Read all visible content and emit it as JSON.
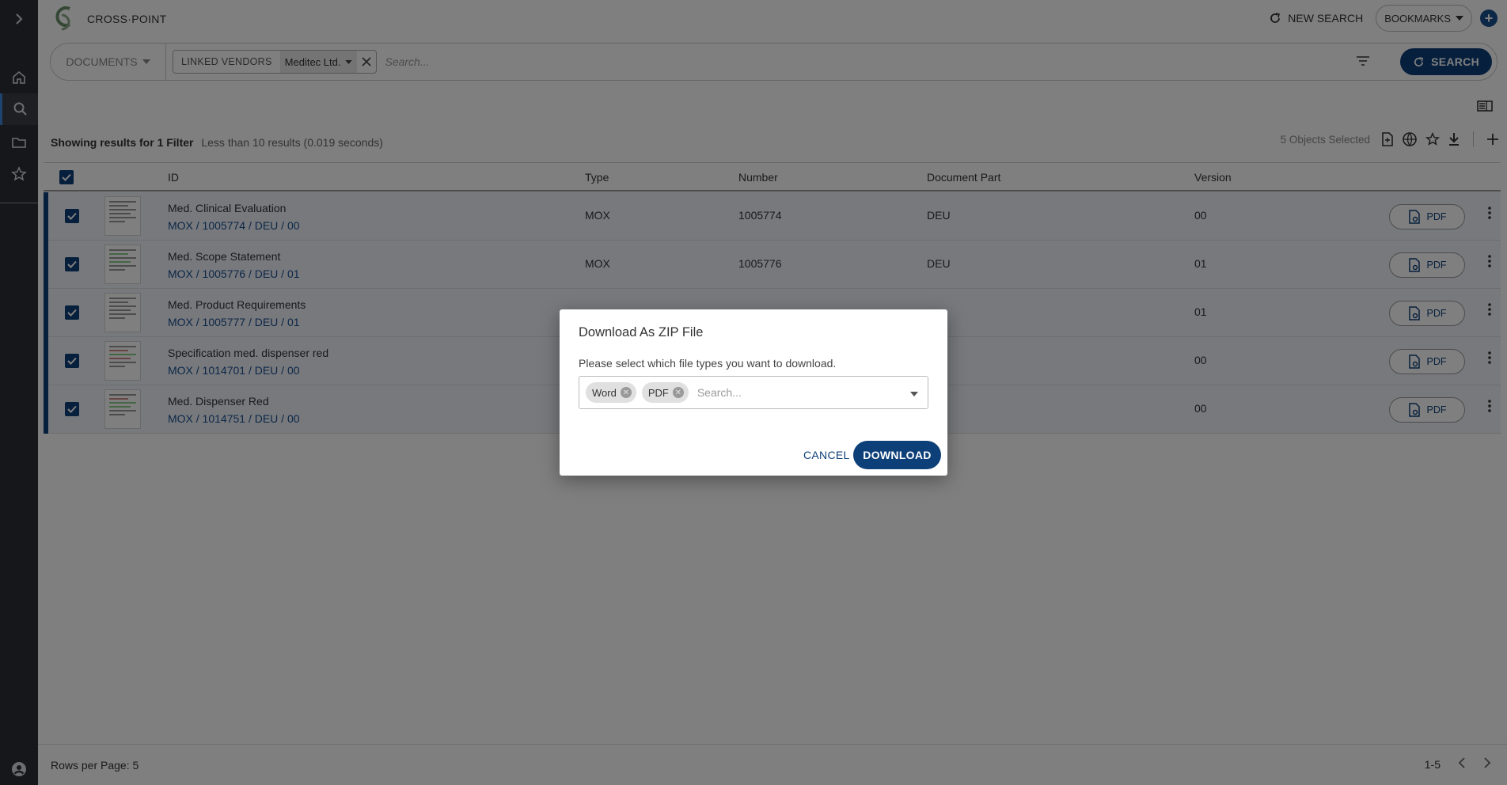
{
  "app": {
    "title": "CROSS·POINT"
  },
  "header": {
    "new_search": "NEW SEARCH",
    "bookmarks": "BOOKMARKS"
  },
  "search": {
    "doc_type": "DOCUMENTS",
    "filter_label": "LINKED VENDORS",
    "filter_value": "Meditec Ltd.",
    "placeholder": "Search...",
    "button": "SEARCH"
  },
  "results": {
    "showing": "Showing results for 1 Filter",
    "summary": "Less than 10 results (0.019 seconds)",
    "selected": "5 Objects Selected"
  },
  "table": {
    "columns": [
      "ID",
      "Type",
      "Number",
      "Document Part",
      "Version"
    ],
    "rows": [
      {
        "title": "Med. Clinical Evaluation",
        "sub": "MOX / 1005774 / DEU / 00",
        "type": "MOX",
        "number": "1005774",
        "part": "DEU",
        "version": "00",
        "action": "PDF"
      },
      {
        "title": "Med. Scope Statement",
        "sub": "MOX / 1005776 / DEU / 01",
        "type": "MOX",
        "number": "1005776",
        "part": "DEU",
        "version": "01",
        "action": "PDF"
      },
      {
        "title": "Med. Product Requirements",
        "sub": "MOX / 1005777 / DEU / 01",
        "type": "",
        "number": "",
        "part": "",
        "version": "01",
        "action": "PDF"
      },
      {
        "title": "Specification med. dispenser red",
        "sub": "MOX / 1014701 / DEU / 00",
        "type": "",
        "number": "",
        "part": "",
        "version": "00",
        "action": "PDF"
      },
      {
        "title": "Med. Dispenser Red",
        "sub": "MOX / 1014751 / DEU / 00",
        "type": "",
        "number": "",
        "part": "",
        "version": "00",
        "action": "PDF"
      }
    ]
  },
  "footer": {
    "rows_per_page": "Rows per Page: 5",
    "range": "1-5"
  },
  "modal": {
    "title": "Download As ZIP File",
    "description": "Please select which file types you want to download.",
    "chips": [
      "Word",
      "PDF"
    ],
    "placeholder": "Search...",
    "cancel": "CANCEL",
    "confirm": "DOWNLOAD"
  },
  "colors": {
    "primary": "#0d3f78",
    "sidebar": "#2b2f36"
  }
}
